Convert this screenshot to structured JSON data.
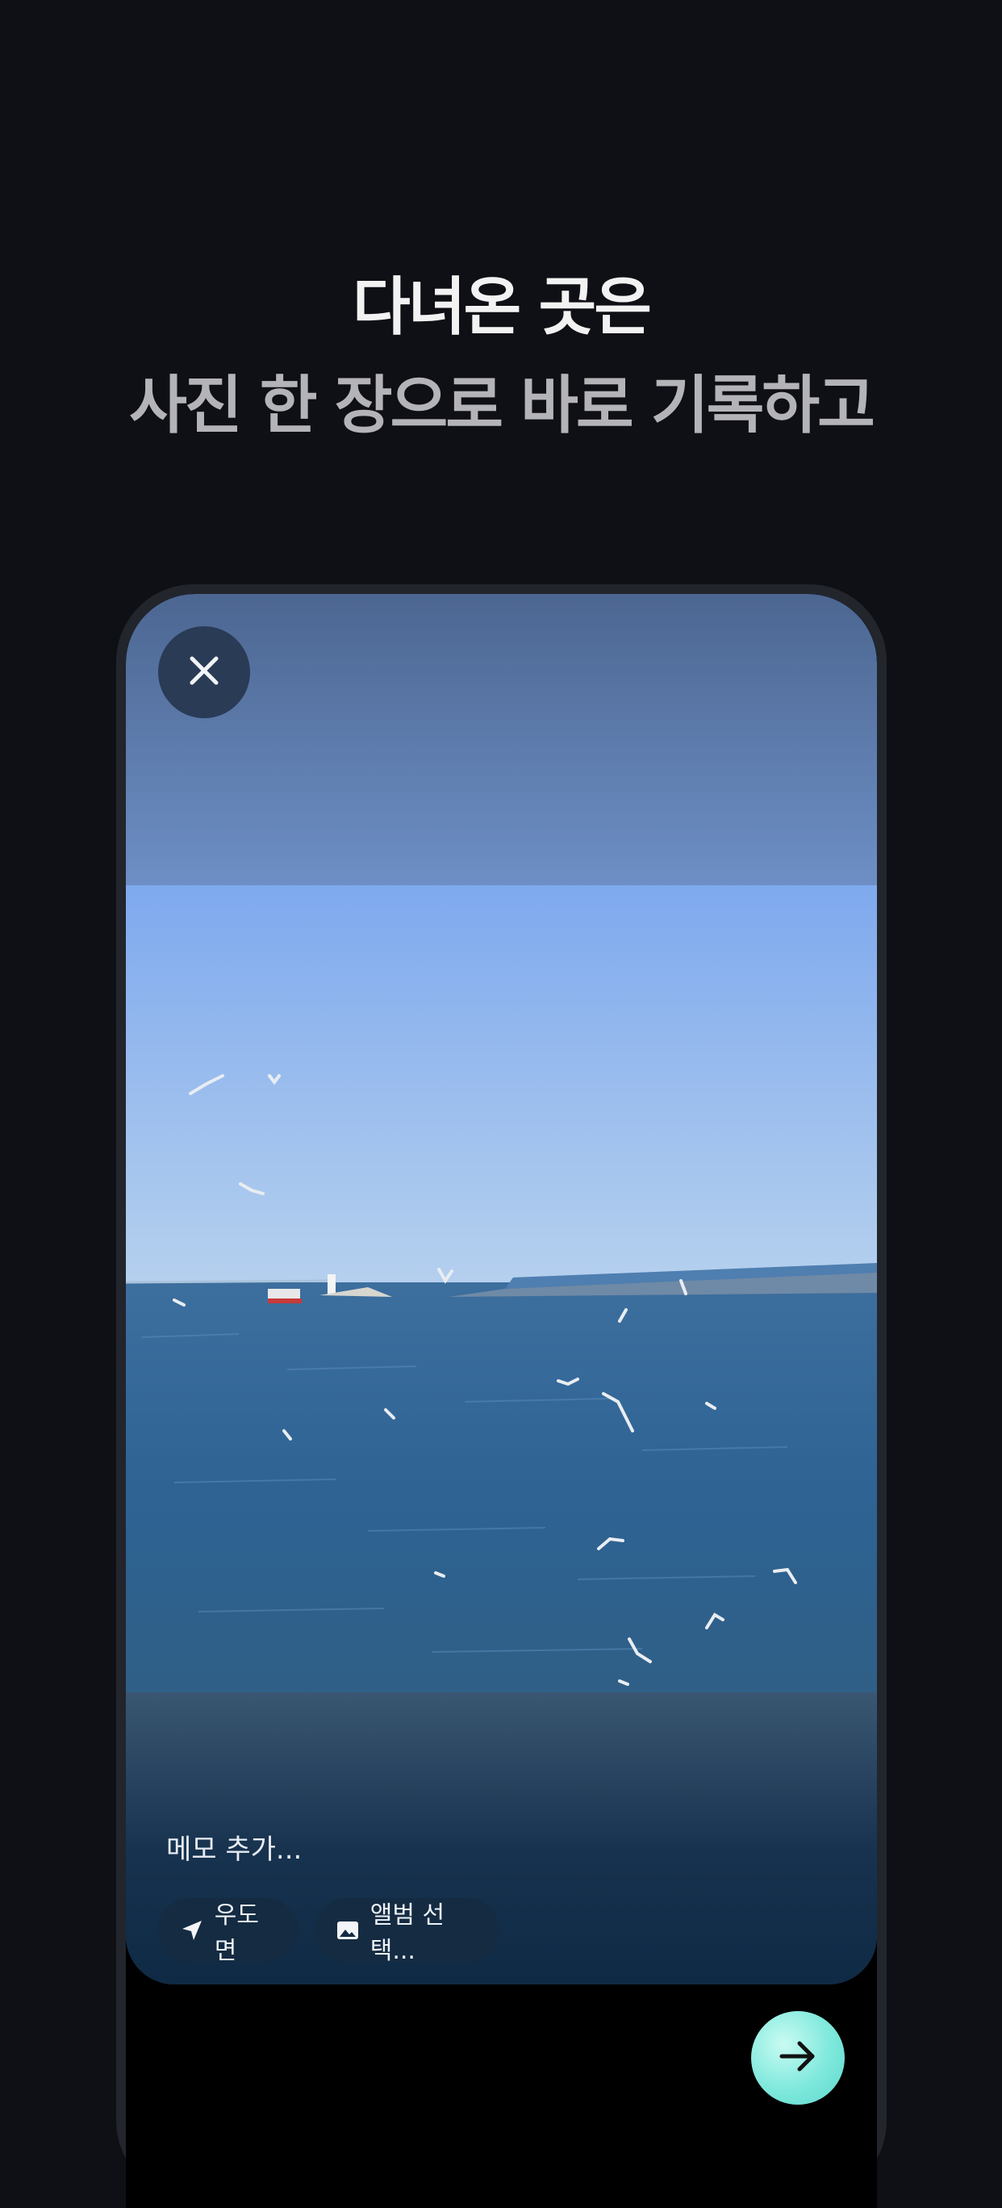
{
  "headline": {
    "line1": "다녀온 곳은",
    "line2": "사진 한 장으로 바로 기록하고"
  },
  "memo": {
    "placeholder": "메모 추가..."
  },
  "chips": {
    "location_label": "우도면",
    "album_label": "앨범 선택..."
  },
  "icons": {
    "close": "close-icon",
    "location": "navigation-arrow-icon",
    "album": "image-icon",
    "next": "arrow-right-icon"
  },
  "colors": {
    "background": "#0f1015",
    "next_button": "#7ee8dc",
    "chip_background": "#142b42"
  }
}
